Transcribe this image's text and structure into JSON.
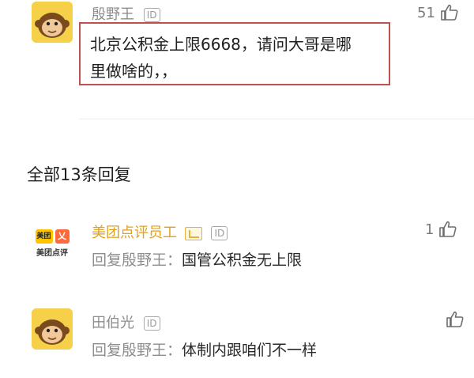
{
  "comment": {
    "author": "殷野王",
    "id_badge": "ID",
    "like_count": "51",
    "text_line1": "北京公积金上限6668，请问大哥是哪",
    "text_line2": "里做啥的，，"
  },
  "replies_header": "全部13条回复",
  "replies": [
    {
      "author": "美团点评员工",
      "id_badge": "ID",
      "like_count": "1",
      "prefix": "回复殷野王：",
      "text": "国管公积金无上限",
      "logo_top_left": "美团",
      "logo_top_right": "乂",
      "logo_caption": "美团点评"
    },
    {
      "author": "田伯光",
      "id_badge": "ID",
      "like_count": "",
      "prefix": "回复殷野王：",
      "text": "体制内跟咱们不一样"
    }
  ],
  "colors": {
    "highlight_border": "#c0504d",
    "avatar_yellow": "#f7d04a",
    "meituan_yellow": "#ffc300",
    "meituan_orange": "#ff6a3d"
  },
  "icons": {
    "like": "thumbs-up-icon",
    "avatar": "monkey-avatar-icon"
  }
}
